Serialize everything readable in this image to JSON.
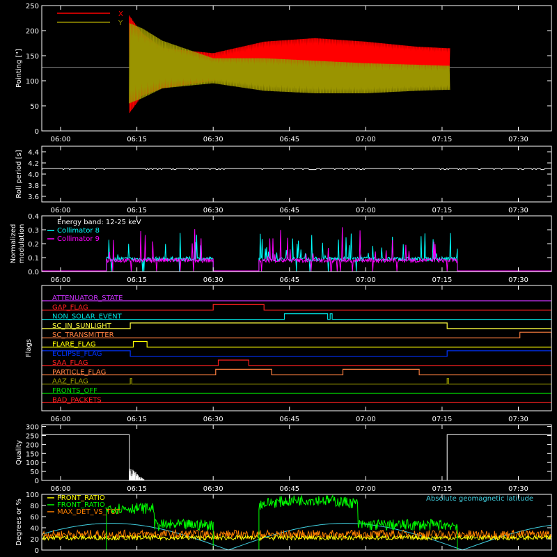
{
  "time_axis": {
    "tick_labels": [
      "06:00",
      "06:15",
      "06:30",
      "06:45",
      "07:00",
      "07:15",
      "07:30"
    ],
    "tick_minutes": [
      0,
      15,
      30,
      45,
      60,
      75,
      90
    ],
    "range_minutes": [
      -3.7,
      96.5
    ]
  },
  "chart_data": [
    {
      "id": "pointing",
      "type": "line",
      "ylabel": "Pointing [\"]",
      "ylim": [
        0,
        250
      ],
      "yticks": [
        0,
        50,
        100,
        150,
        200,
        250
      ],
      "reference_level": 127,
      "data_window": [
        13.5,
        76.5
      ],
      "series": [
        {
          "name": "X",
          "color": "#ff0000",
          "envelope": [
            {
              "t": 13.5,
              "min": 35,
              "max": 230
            },
            {
              "t": 16,
              "min": 70,
              "max": 195
            },
            {
              "t": 20,
              "min": 85,
              "max": 165
            },
            {
              "t": 30,
              "min": 100,
              "max": 155
            },
            {
              "t": 40,
              "min": 115,
              "max": 178
            },
            {
              "t": 50,
              "min": 118,
              "max": 185
            },
            {
              "t": 60,
              "min": 120,
              "max": 178
            },
            {
              "t": 70,
              "min": 122,
              "max": 168
            },
            {
              "t": 76,
              "min": 122,
              "max": 165
            }
          ]
        },
        {
          "name": "Y",
          "color": "#9a9400",
          "envelope": [
            {
              "t": 13.5,
              "min": 55,
              "max": 215
            },
            {
              "t": 16,
              "min": 65,
              "max": 205
            },
            {
              "t": 20,
              "min": 85,
              "max": 180
            },
            {
              "t": 30,
              "min": 95,
              "max": 145
            },
            {
              "t": 40,
              "min": 80,
              "max": 145
            },
            {
              "t": 50,
              "min": 75,
              "max": 140
            },
            {
              "t": 60,
              "min": 75,
              "max": 135
            },
            {
              "t": 70,
              "min": 80,
              "max": 132
            },
            {
              "t": 76,
              "min": 82,
              "max": 130
            }
          ]
        }
      ]
    },
    {
      "id": "roll",
      "type": "line",
      "ylabel": "Roll period [s]",
      "ylim": [
        3.5,
        4.5
      ],
      "yticks": [
        3.6,
        3.8,
        4.0,
        4.2,
        4.4
      ],
      "series": [
        {
          "color": "#ffffff",
          "value": 4.1
        }
      ]
    },
    {
      "id": "modulation",
      "type": "line",
      "ylabel": [
        "Normalized",
        "modulation"
      ],
      "ylim": [
        0,
        0.4
      ],
      "yticks": [
        0.0,
        0.1,
        0.2,
        0.3,
        0.4
      ],
      "annotation": "Energy band: 12-25 keV",
      "segments": [
        [
          9.0,
          30.0
        ],
        [
          39.0,
          78.0
        ]
      ],
      "series": [
        {
          "name": "Collimator 8",
          "color": "#00ffff",
          "base": 0.09,
          "peak": 0.28
        },
        {
          "name": "Collimator 9",
          "color": "#ff00ff",
          "base": 0.08,
          "peak": 0.34
        }
      ]
    },
    {
      "id": "flags",
      "type": "step",
      "ylabel": "Flags",
      "flags": [
        {
          "name": "ATTENUATOR_STATE",
          "color": "#cc33ff",
          "high": []
        },
        {
          "name": "GAP_FLAG",
          "color": "#ff2020",
          "high": [
            [
              30.0,
              40.0
            ]
          ]
        },
        {
          "name": "NON_SOLAR_EVENT",
          "color": "#00e0e0",
          "high": [
            [
              44.0,
              52.5
            ],
            [
              53.0,
              53.4
            ]
          ]
        },
        {
          "name": "SC_IN_SUNLIGHT",
          "color": "#ffff40",
          "high": [
            [
              13.7,
              76.0
            ]
          ]
        },
        {
          "name": "SC_TRANSMITTER",
          "color": "#ff8040",
          "high": [
            [
              90.3,
              96.5
            ]
          ]
        },
        {
          "name": "FLARE_FLAG",
          "color": "#ffff00",
          "high": [
            [
              14.3,
              17.0
            ]
          ]
        },
        {
          "name": "ECLIPSE_FLAG",
          "color": "#0033ff",
          "high": [
            [
              -3.7,
              13.7
            ],
            [
              76.0,
              96.5
            ]
          ]
        },
        {
          "name": "SAA_FLAG",
          "color": "#ff2020",
          "high": [
            [
              31.0,
              37.0
            ]
          ]
        },
        {
          "name": "PARTICLE_FLAG",
          "color": "#ff8040",
          "high": [
            [
              30.5,
              41.5
            ],
            [
              55.5,
              70.5
            ]
          ]
        },
        {
          "name": "AAZ_FLAG",
          "color": "#999900",
          "high": [
            [
              13.7,
              14.0
            ],
            [
              76.0,
              76.3
            ]
          ]
        },
        {
          "name": "FRONTS_OFF",
          "color": "#00dd00",
          "high": []
        },
        {
          "name": "BAD_PACKETS",
          "color": "#ff2020",
          "high": []
        }
      ]
    },
    {
      "id": "quality",
      "type": "step",
      "ylabel": "Quality",
      "ylim": [
        0,
        310
      ],
      "yticks": [
        0,
        50,
        100,
        150,
        200,
        250,
        300
      ],
      "series": [
        {
          "color": "#ffffff",
          "steps": [
            [
              -3.7,
              255
            ],
            [
              13.5,
              0
            ],
            [
              76.0,
              255
            ],
            [
              96.5,
              255
            ]
          ]
        }
      ]
    },
    {
      "id": "geomag",
      "type": "line",
      "ylabel": "Degrees or %",
      "ylim": [
        0,
        100
      ],
      "yticks": [
        0,
        20,
        40,
        60,
        80,
        100
      ],
      "annotation": "Absolute geomagnetic latitude",
      "series": [
        {
          "name": "FRONT_RATIO",
          "color": "#ffff00",
          "level": 22
        },
        {
          "name": "FRONT_RATIO_",
          "color": "#00ff00",
          "segments": [
            [
              9.0,
              30.0
            ],
            [
              39.0,
              78.0
            ]
          ],
          "outside": 0
        },
        {
          "name": "MAX_DET_VS_TOT",
          "color": "#ff8000",
          "level": 28
        },
        {
          "name": "Absolute geomagnetic latitude",
          "color": "#40d0e0",
          "amplitude": 48,
          "period_minutes": 46,
          "phase_minutes": 10
        }
      ]
    }
  ]
}
